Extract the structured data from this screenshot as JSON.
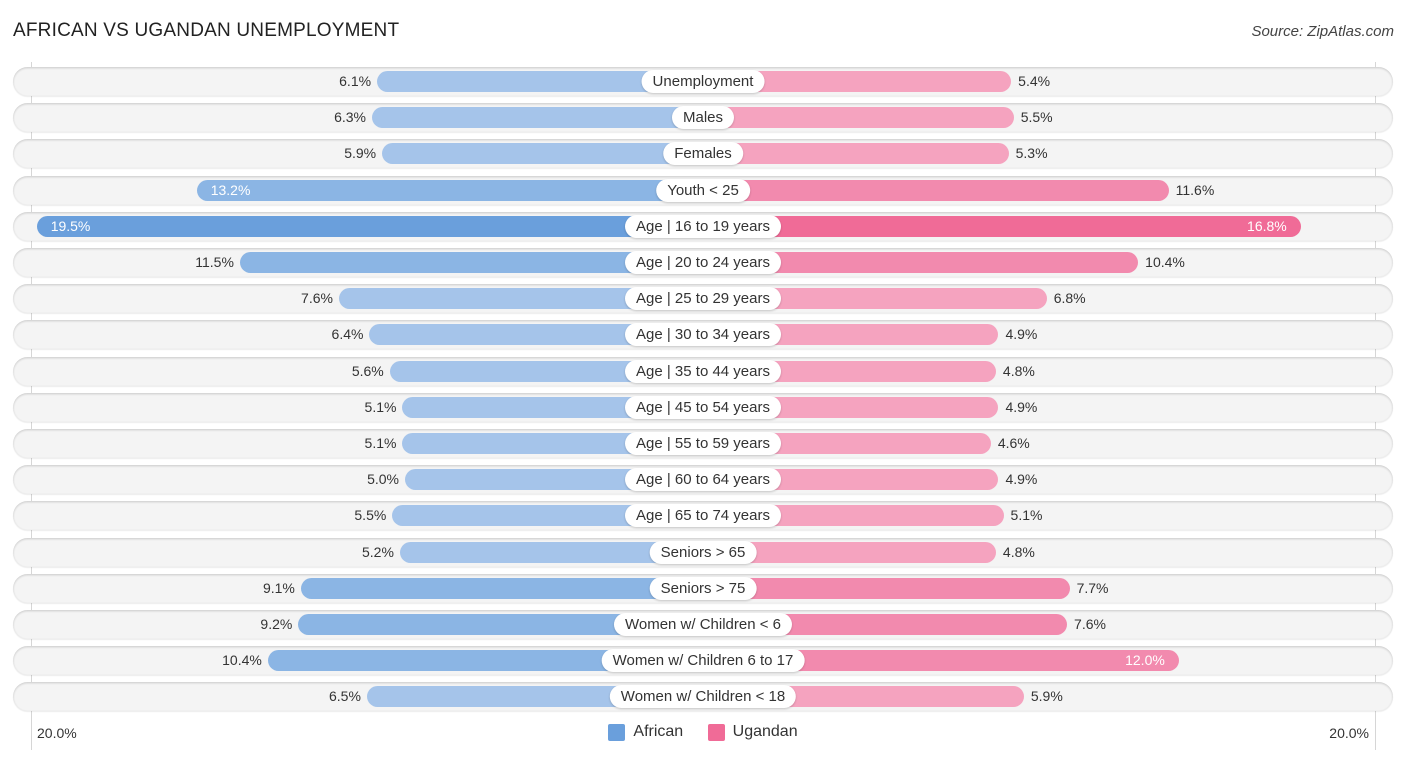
{
  "header": {
    "title": "AFRICAN VS UGANDAN UNEMPLOYMENT",
    "source": "Source: ZipAtlas.com"
  },
  "colors": {
    "african": "#6a9fdc",
    "ugandan": "#f06b97",
    "african_light": "#a5c4ea",
    "ugandan_light": "#f5a3bf"
  },
  "chart_data": {
    "type": "bar",
    "orientation": "horizontal-diverging",
    "title": "AFRICAN VS UGANDAN UNEMPLOYMENT",
    "xlabel": "",
    "ylabel": "",
    "xlim": [
      -20.0,
      20.0
    ],
    "axis_labels": {
      "left": "20.0%",
      "right": "20.0%"
    },
    "legend": {
      "position": "bottom-center",
      "entries": [
        "African",
        "Ugandan"
      ]
    },
    "categories": [
      "Unemployment",
      "Males",
      "Females",
      "Youth < 25",
      "Age | 16 to 19 years",
      "Age | 20 to 24 years",
      "Age | 25 to 29 years",
      "Age | 30 to 34 years",
      "Age | 35 to 44 years",
      "Age | 45 to 54 years",
      "Age | 55 to 59 years",
      "Age | 60 to 64 years",
      "Age | 65 to 74 years",
      "Seniors > 65",
      "Seniors > 75",
      "Women w/ Children < 6",
      "Women w/ Children 6 to 17",
      "Women w/ Children < 18"
    ],
    "series": [
      {
        "name": "African",
        "side": "left",
        "values": [
          6.1,
          6.3,
          5.9,
          13.2,
          19.5,
          11.5,
          7.6,
          6.4,
          5.6,
          5.1,
          5.1,
          5.0,
          5.5,
          5.2,
          9.1,
          9.2,
          10.4,
          6.5
        ],
        "labels": [
          "6.1%",
          "6.3%",
          "5.9%",
          "13.2%",
          "19.5%",
          "11.5%",
          "7.6%",
          "6.4%",
          "5.6%",
          "5.1%",
          "5.1%",
          "5.0%",
          "5.5%",
          "5.2%",
          "9.1%",
          "9.2%",
          "10.4%",
          "6.5%"
        ]
      },
      {
        "name": "Ugandan",
        "side": "right",
        "values": [
          5.4,
          5.5,
          5.3,
          11.6,
          16.8,
          10.4,
          6.8,
          4.9,
          4.8,
          4.9,
          4.6,
          4.9,
          5.1,
          4.8,
          7.7,
          7.6,
          12.0,
          5.9
        ],
        "labels": [
          "5.4%",
          "5.5%",
          "5.3%",
          "11.6%",
          "16.8%",
          "10.4%",
          "6.8%",
          "4.9%",
          "4.8%",
          "4.9%",
          "4.6%",
          "4.9%",
          "5.1%",
          "4.8%",
          "7.7%",
          "7.6%",
          "12.0%",
          "5.9%"
        ]
      }
    ]
  }
}
